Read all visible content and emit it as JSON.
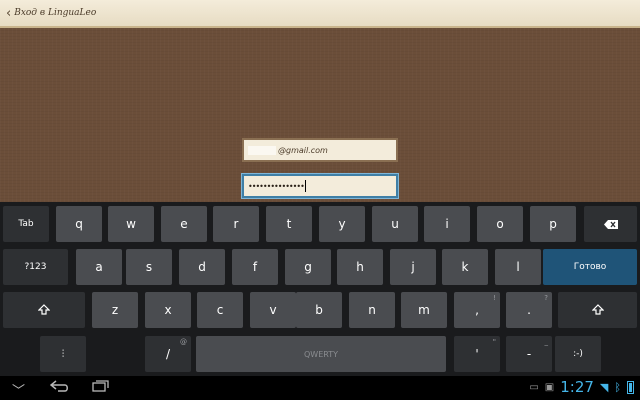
{
  "header": {
    "back_label": "Вход в LinguaLeo"
  },
  "form": {
    "email_domain": "@gmail.com",
    "password_masked": "•••••••••••••••"
  },
  "keyboard": {
    "row1": [
      "q",
      "w",
      "e",
      "r",
      "t",
      "y",
      "u",
      "i",
      "o",
      "p"
    ],
    "row2": [
      "a",
      "s",
      "d",
      "f",
      "g",
      "h",
      "j",
      "k",
      "l"
    ],
    "row3": [
      "z",
      "x",
      "c",
      "v",
      "b",
      "n",
      "m"
    ],
    "tab": "Tab",
    "sym": "?123",
    "done": "Готово",
    "space": "QWERTY",
    "slash": "/",
    "slash_hint": "@",
    "comma": ",",
    "comma_hint": "!",
    "period": ".",
    "period_hint": "?",
    "apostrophe": "'",
    "apostrophe_hint": "\"",
    "dash": "-",
    "dash_hint": "_",
    "smiley": ":-)"
  },
  "status": {
    "time": "1:27"
  },
  "colors": {
    "accent": "#45b5e8",
    "done_key": "#1f5478",
    "focus": "#3f7fa6"
  }
}
